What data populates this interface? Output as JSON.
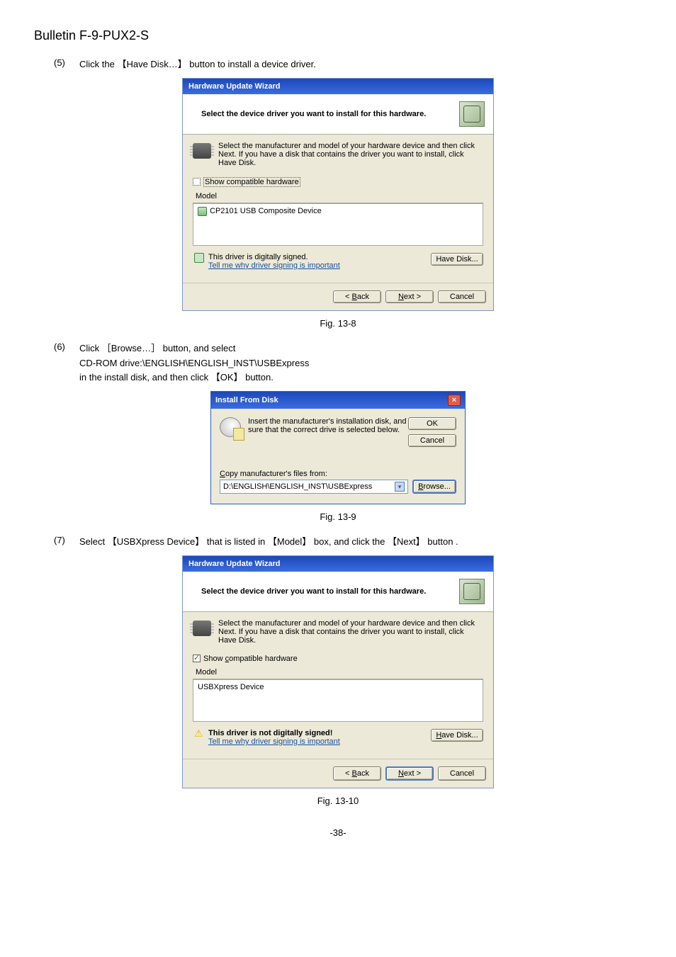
{
  "bulletin_title": "Bulletin F-9-PUX2-S",
  "step5": {
    "num": "(5)",
    "text": "Click the 【Have Disk…】 button to install a device driver."
  },
  "step6": {
    "num": "(6)",
    "line1": "Click ［Browse…］ button, and select",
    "line2": "CD-ROM drive:\\ENGLISH\\ENGLISH_INST\\USBExpress",
    "line3": "in the install disk, and then click 【OK】 button."
  },
  "step7": {
    "num": "(7)",
    "text": "Select 【USBXpress Device】 that is listed in 【Model】 box, and click the 【Next】 button ."
  },
  "fig8": "Fig. 13-8",
  "fig9": "Fig. 13-9",
  "fig10": "Fig. 13-10",
  "wizard1": {
    "title": "Hardware Update Wizard",
    "heading": "Select the device driver you want to install for this hardware.",
    "instruction": "Select the manufacturer and model of your hardware device and then click Next. If you have a disk that contains the driver you want to install, click Have Disk.",
    "show_compat": "Show compatible hardware",
    "model_hdr": "Model",
    "model_item": "CP2101 USB Composite Device",
    "signed_text": "This driver is digitally signed.",
    "link": "Tell me why driver signing is important",
    "have_disk": "Have Disk...",
    "back": "< Back",
    "next": "Next >",
    "cancel": "Cancel"
  },
  "ifd": {
    "title": "Install From Disk",
    "instruction": "Insert the manufacturer's installation disk, and then make sure that the correct drive is selected below.",
    "ok": "OK",
    "cancel": "Cancel",
    "copy_label": "Copy manufacturer's files from:",
    "path": "D:\\ENGLISH\\ENGLISH_INST\\USBExpress",
    "browse": "Browse..."
  },
  "wizard2": {
    "title": "Hardware Update Wizard",
    "heading": "Select the device driver you want to install for this hardware.",
    "instruction": "Select the manufacturer and model of your hardware device and then click Next. If you have a disk that contains the driver you want to install, click Have Disk.",
    "show_compat": "Show compatible hardware",
    "model_hdr": "Model",
    "model_item": "USBXpress Device",
    "unsigned_text": "This driver is not digitally signed!",
    "link": "Tell me why driver signing is important",
    "have_disk": "Have Disk...",
    "back": "< Back",
    "next": "Next >",
    "cancel": "Cancel"
  },
  "page_number": "-38-"
}
